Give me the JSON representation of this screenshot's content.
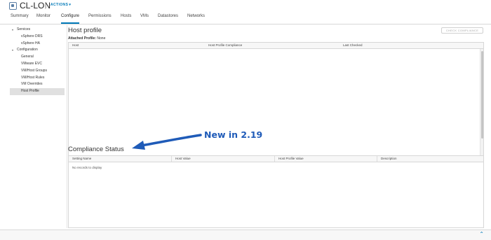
{
  "header": {
    "title": "CL-LON",
    "actions_label": "ACTIONS",
    "tabs": [
      {
        "label": "Summary",
        "active": false
      },
      {
        "label": "Monitor",
        "active": false
      },
      {
        "label": "Configure",
        "active": true
      },
      {
        "label": "Permissions",
        "active": false
      },
      {
        "label": "Hosts",
        "active": false
      },
      {
        "label": "VMs",
        "active": false
      },
      {
        "label": "Datastores",
        "active": false
      },
      {
        "label": "Networks",
        "active": false
      }
    ]
  },
  "sidebar": {
    "groups": [
      {
        "label": "Services",
        "expanded": true,
        "items": [
          {
            "label": "vSphere DRS"
          },
          {
            "label": "vSphere HA"
          }
        ]
      },
      {
        "label": "Configuration",
        "expanded": true,
        "items": [
          {
            "label": "General"
          },
          {
            "label": "VMware EVC"
          },
          {
            "label": "VM/Host Groups"
          },
          {
            "label": "VM/Host Rules"
          },
          {
            "label": "VM Overrides"
          },
          {
            "label": "Host Profile",
            "selected": true
          }
        ]
      }
    ]
  },
  "host_profile": {
    "title": "Host profile",
    "attached_label": "Attached Profile:",
    "attached_value": "None",
    "check_button": "CHECK COMPLIANCE",
    "columns": [
      "Host",
      "Host Profile Compliance",
      "Last Checked"
    ]
  },
  "compliance": {
    "title": "Compliance Status",
    "columns": [
      "Setting Name",
      "Host Value",
      "Host Profile Value",
      "Description"
    ],
    "empty_text": "No records to display"
  },
  "annotation": {
    "label": "New in 2.19",
    "color": "#1f5bb8"
  },
  "icons": {
    "object": "cluster-icon",
    "footer": "double-chevron-up-icon"
  },
  "colors": {
    "accent": "#0079b8",
    "selected_bg": "#e0e0e0"
  }
}
